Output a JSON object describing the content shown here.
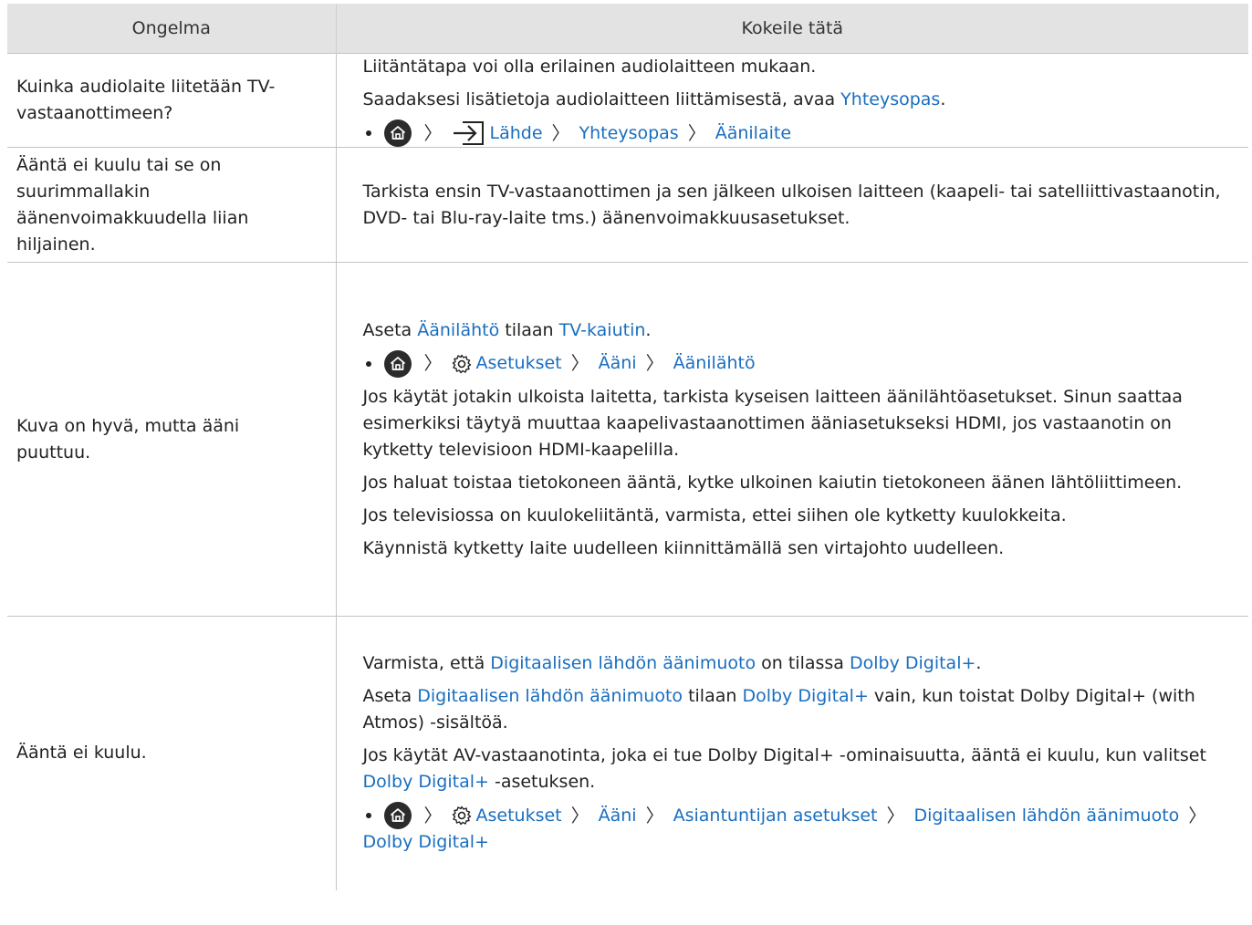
{
  "header": {
    "col1": "Ongelma",
    "col2": "Kokeile tätä"
  },
  "rows": [
    {
      "problem": "Kuinka audiolaite liitetään TV-vastaanottimeen?",
      "p1": "Liitäntätapa voi olla erilainen audiolaitteen mukaan.",
      "p2_pre": "Saadaksesi lisätietoja audiolaitteen liittämisestä, avaa ",
      "p2_link": "Yhteysopas",
      "p2_post": ".",
      "path": [
        "Lähde",
        "Yhteysopas",
        "Äänilaite"
      ]
    },
    {
      "problem": "Ääntä ei kuulu tai se on suurimmallakin äänenvoimakkuudella liian hiljainen.",
      "p1": "Tarkista ensin TV-vastaanottimen ja sen jälkeen ulkoisen laitteen (kaapeli- tai satelliittivastaanotin, DVD- tai Blu-ray-laite tms.) äänenvoimakkuusasetukset."
    },
    {
      "problem": "Kuva on hyvä, mutta ääni puuttuu.",
      "p1_pre": "Aseta ",
      "p1_link1": "Äänilähtö",
      "p1_mid": " tilaan ",
      "p1_link2": "TV-kaiutin",
      "p1_post": ".",
      "path": [
        "Asetukset",
        "Ääni",
        "Äänilähtö"
      ],
      "p2": "Jos käytät jotakin ulkoista laitetta, tarkista kyseisen laitteen äänilähtöasetukset. Sinun saattaa esimerkiksi täytyä muuttaa kaapelivastaanottimen ääniasetukseksi HDMI, jos vastaanotin on kytketty televisioon HDMI-kaapelilla.",
      "p3": "Jos haluat toistaa tietokoneen ääntä, kytke ulkoinen kaiutin tietokoneen äänen lähtöliittimeen.",
      "p4": "Jos televisiossa on kuulokeliitäntä, varmista, ettei siihen ole kytketty kuulokkeita.",
      "p5": "Käynnistä kytketty laite uudelleen kiinnittämällä sen virtajohto uudelleen."
    },
    {
      "problem": "Ääntä ei kuulu.",
      "p1_pre": "Varmista, että ",
      "p1_link1": "Digitaalisen lähdön äänimuoto",
      "p1_mid": " on tilassa ",
      "p1_link2": "Dolby Digital+",
      "p1_post": ".",
      "p2_pre": "Aseta ",
      "p2_link1": "Digitaalisen lähdön äänimuoto",
      "p2_mid": " tilaan ",
      "p2_link2": "Dolby Digital+",
      "p2_post": " vain, kun toistat Dolby Digital+ (with Atmos) -sisältöä.",
      "p3_pre": "Jos käytät AV-vastaanotinta, joka ei tue Dolby Digital+ -ominaisuutta, ääntä ei kuulu, kun valitset ",
      "p3_link": "Dolby Digital+",
      "p3_post": " -asetuksen.",
      "path": [
        "Asetukset",
        "Ääni",
        "Asiantuntijan asetukset",
        "Digitaalisen lähdön äänimuoto",
        "Dolby Digital+"
      ]
    }
  ],
  "colors": {
    "link": "#1a6ebf",
    "header_bg": "#e3e3e3",
    "border": "#c4c4c4"
  },
  "icons": [
    "home-icon",
    "source-icon",
    "gear-icon",
    "chevron-right-icon"
  ]
}
